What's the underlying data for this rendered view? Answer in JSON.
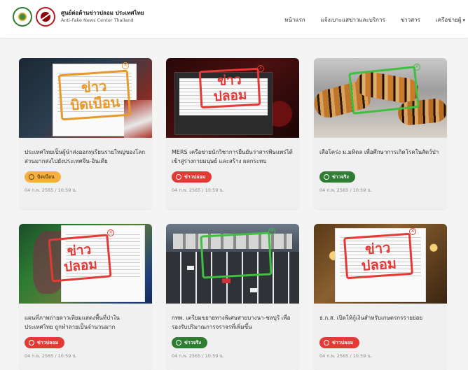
{
  "header": {
    "logo_th": "ศูนย์ต่อต้านข่าวปลอม ประเทศไทย",
    "logo_en": "Anti-Fake News Center Thailand",
    "nav": [
      "หน้าแรก",
      "แจ้งเบาะแสข่าวและบริการ",
      "ข่าวสาร",
      "เครือข่ายผู้"
    ]
  },
  "colors": {
    "fake": "#e53935",
    "true": "#2e7d32",
    "distorted": "#f5b041"
  },
  "cards": [
    {
      "stamp": [
        "ข่าว",
        "บิดเบือน"
      ],
      "title": "ประเทศไทยเป็นผู้นำส่งออกทุเรียนรายใหญ่ของโลก ส่วนมากส่งไปยังประเทศจีน-อินเดีย",
      "badge": "บิดเบือน",
      "status": "distorted",
      "date": "04 ก.พ. 2565 / 10:59 น."
    },
    {
      "stamp": [
        "ข่าว",
        "ปลอม"
      ],
      "title": "MERS เครือข่ายนักวิชาการยืนยันว่าสารพิษแพร่ได้เข้าสู่ร่างกายมนุษย์ และสร้าง ผลกระทบ",
      "badge": "ข่าวปลอม",
      "status": "fake",
      "date": "04 ก.พ. 2565 / 10:59 น."
    },
    {
      "stamp": [],
      "title": "เสือโคร่ง ม.มหิดล เพื่อศึกษาการเกิดโรคในสัตว์ป่า",
      "badge": "ข่าวจริง",
      "status": "true",
      "date": "04 ก.พ. 2565 / 10:59 น."
    },
    {
      "stamp": [
        "ข่าว",
        "ปลอม"
      ],
      "title": "แผนที่ภาพถ่ายดาวเทียมแสดงพื้นที่ป่าในประเทศไทย ถูกทำลายเป็นจำนวนมาก",
      "badge": "ข่าวปลอม",
      "status": "fake",
      "date": "04 ก.พ. 2565 / 10:59 น."
    },
    {
      "stamp": [],
      "title": "กทพ. เตรียมขยายทางพิเศษสายบางนา-ชลบุรี เพื่อรองรับปริมาณการจราจรที่เพิ่มขึ้น",
      "badge": "ข่าวจริง",
      "status": "true",
      "date": "04 ก.พ. 2565 / 10:59 น."
    },
    {
      "stamp": [
        "ข่าว",
        "ปลอม"
      ],
      "title": "ธ.ก.ส. เปิดให้กู้เงินสำหรับเกษตรกรรายย่อย",
      "badge": "ข่าวปลอม",
      "status": "fake",
      "date": "04 ก.พ. 2565 / 10:59 น."
    }
  ]
}
